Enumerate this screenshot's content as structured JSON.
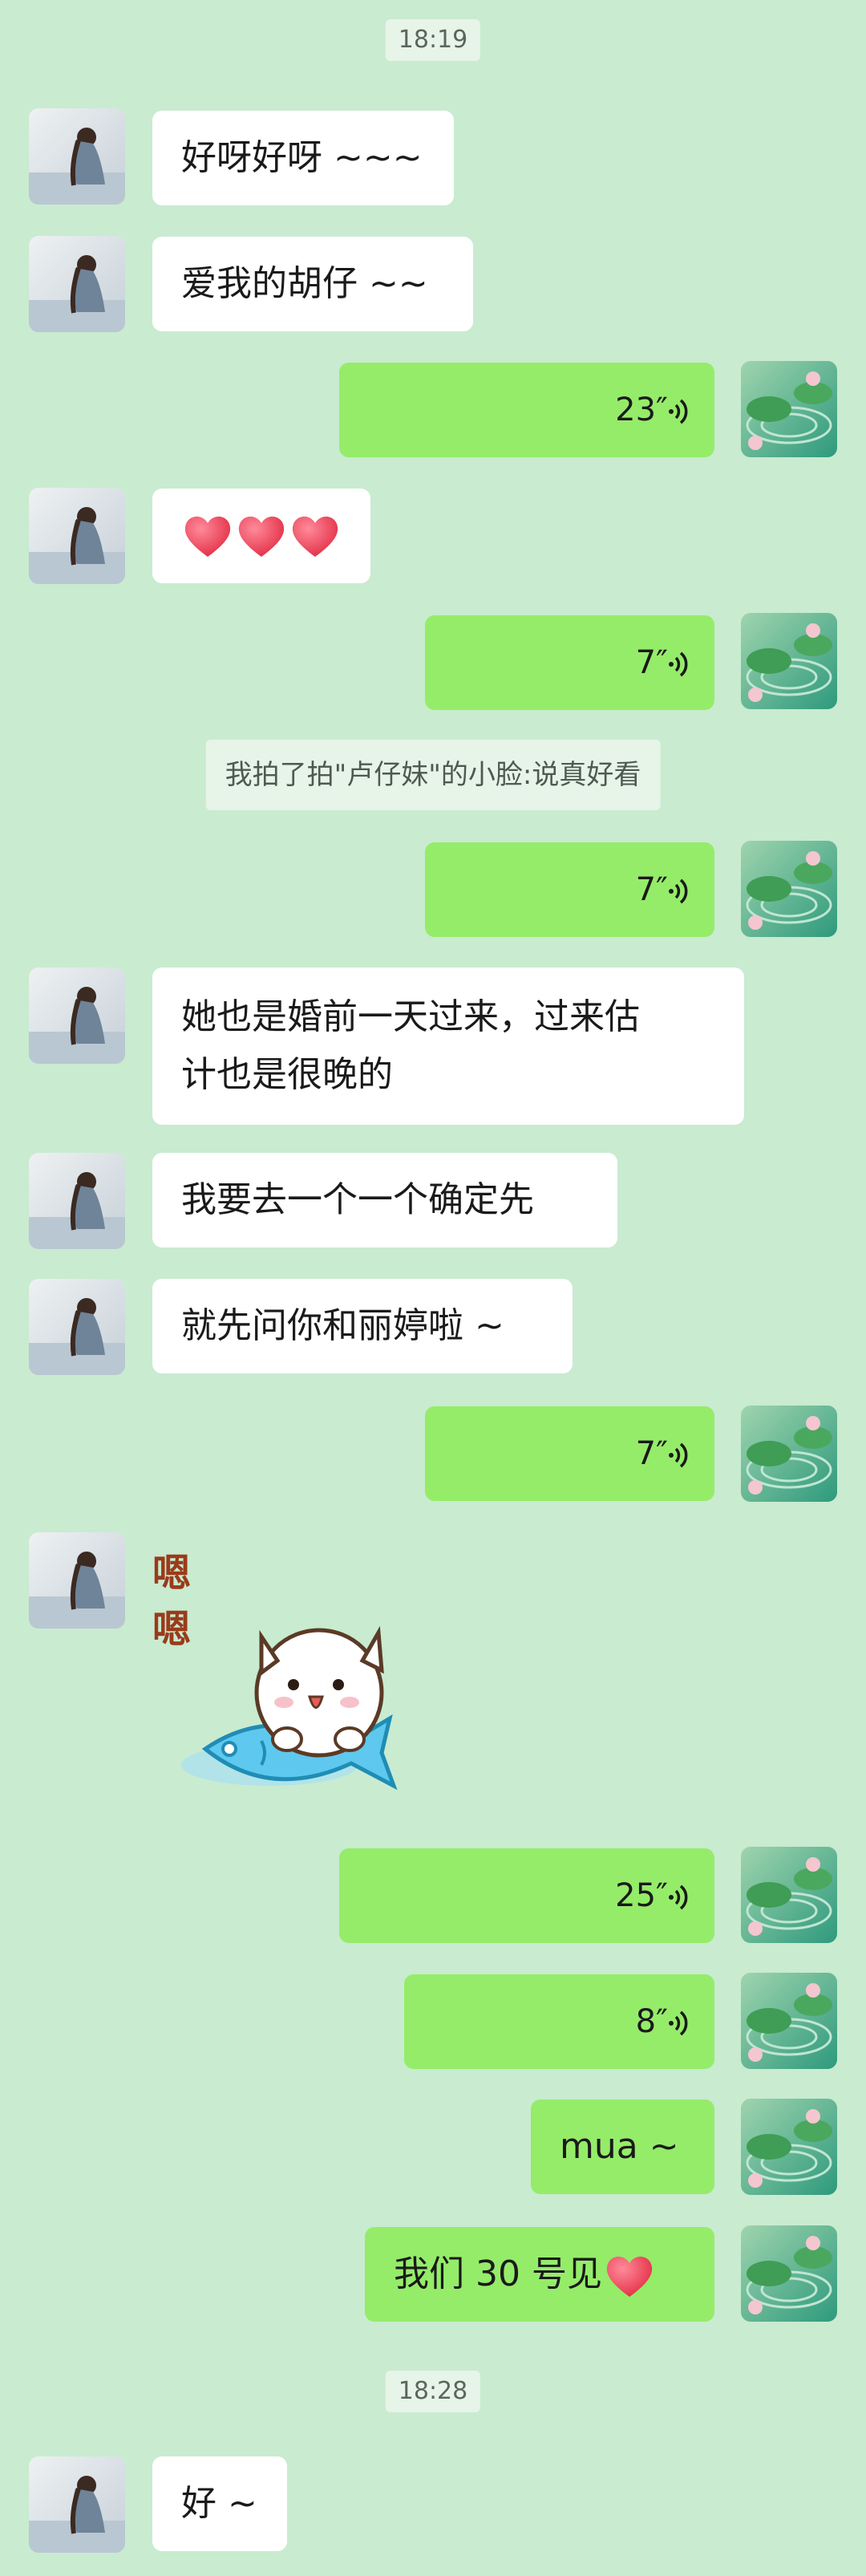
{
  "times": [
    "18:19",
    "18:28"
  ],
  "messages": {
    "m1": "好呀好呀 ~~~",
    "m2": "爱我的胡仔 ~~",
    "v1": "23″",
    "v2": "7″",
    "system": "我拍了拍\"卢仔妹\"的小脸:说真好看",
    "v3": "7″",
    "m3_line1": "她也是婚前一天过来，过来估",
    "m3_line2": "计也是很晚的",
    "m4": "我要去一个一个确定先",
    "m5": "就先问你和丽婷啦 ~",
    "v4": "7″",
    "sticker_text": "嗯嗯",
    "v5": "25″",
    "v6": "8″",
    "m6": "mua ~",
    "m7": "我们 30 号见",
    "m8": "好 ~"
  },
  "colors": {
    "background": "#c9ebd0",
    "outgoing": "#95ec69",
    "incoming": "#ffffff"
  },
  "icons": {
    "voice": "voice-wave-icon",
    "heart": "heart-emoji-icon",
    "sticker": "cat-on-fish-sticker"
  }
}
